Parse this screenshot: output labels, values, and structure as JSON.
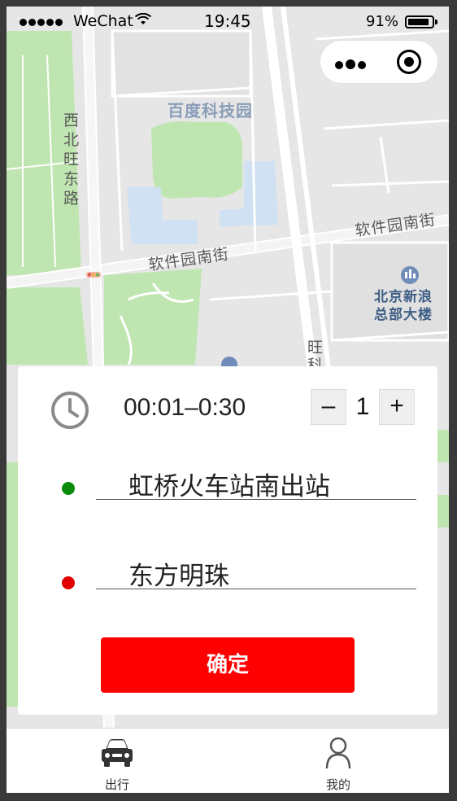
{
  "status_bar": {
    "carrier": "WeChat",
    "time": "19:45",
    "battery_percent": "91%",
    "battery_level": 0.91
  },
  "capsule": {
    "more_icon": "more-dots-icon",
    "close_icon": "target-close-icon"
  },
  "map": {
    "labels": {
      "park": "百度科技园",
      "road_xibeiwang": "西北旺东路",
      "road_ruanjian_left": "软件园南街",
      "road_ruanjian_right": "软件园南街",
      "poi_sina": "北京新浪\n总部大楼",
      "road_wang": "旺\n科"
    }
  },
  "order": {
    "clock_icon": "clock-icon",
    "time_range": "00:01–0:30",
    "passenger_count": "1",
    "minus_label": "–",
    "plus_label": "+",
    "start_location": "虹桥火车站南出站",
    "end_location": "东方明珠",
    "confirm_label": "确定",
    "colors": {
      "start_dot": "#0a8a0a",
      "end_dot": "#e00000",
      "confirm_button": "#ff0000"
    }
  },
  "tabbar": {
    "tabs": [
      {
        "label": "出行",
        "icon": "car-icon"
      },
      {
        "label": "我的",
        "icon": "person-icon"
      }
    ]
  }
}
